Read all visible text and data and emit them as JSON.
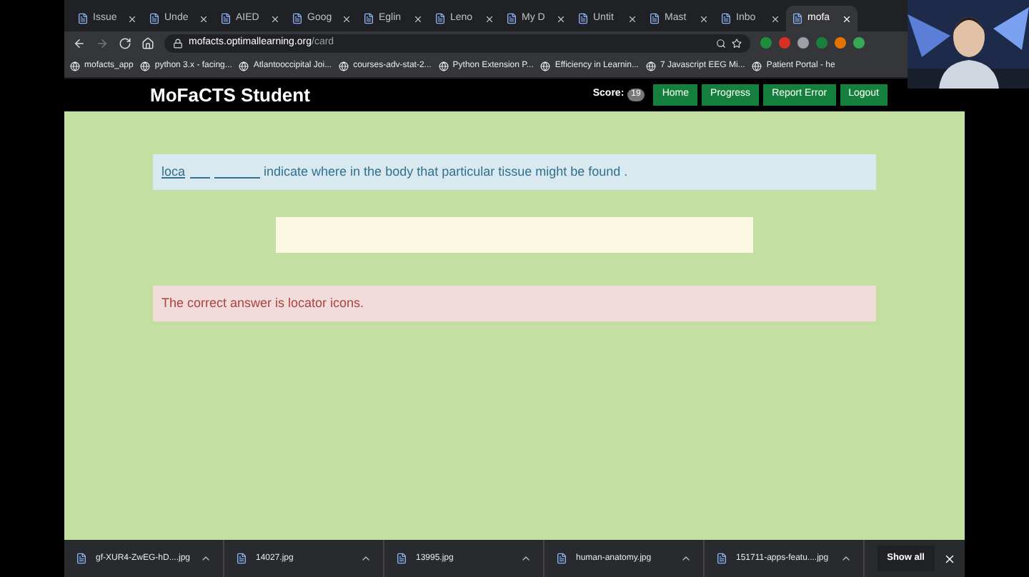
{
  "browser": {
    "tabs": [
      {
        "title": "Issue",
        "selected": false
      },
      {
        "title": "Unde",
        "selected": false
      },
      {
        "title": "AIED",
        "selected": false
      },
      {
        "title": "Goog",
        "selected": false
      },
      {
        "title": "Eglin",
        "selected": false
      },
      {
        "title": "Leno",
        "selected": false
      },
      {
        "title": "My D",
        "selected": false
      },
      {
        "title": "Untit",
        "selected": false
      },
      {
        "title": "Mast",
        "selected": false
      },
      {
        "title": "Inbo",
        "selected": false
      },
      {
        "title": "mofa",
        "selected": true
      }
    ],
    "url": {
      "host": "mofacts.optimallearning.org",
      "path": "/card"
    },
    "bookmarks": [
      "mofacts_app",
      "python 3.x - facing...",
      "Atlantooccipital Joi...",
      "courses-adv-stat-2...",
      "Python Extension P...",
      "Efficiency in Learnin...",
      "7 Javascript EEG Mi...",
      "Patient Portal - he"
    ]
  },
  "app": {
    "title": "MoFaCTS Student",
    "score_label": "Score:",
    "score": "19",
    "nav": [
      "Home",
      "Progress",
      "Report Error",
      "Logout"
    ]
  },
  "card": {
    "prompt_hint": "loca",
    "prompt_text": "indicate where in the body that particular tissue might be found .",
    "feedback": "The correct answer is locator icons."
  },
  "downloads": {
    "files": [
      "gf-XUR4-ZwEG-hD....jpg",
      "14027.jpg",
      "13995.jpg",
      "human-anatomy.jpg",
      "151711-apps-featu....jpg"
    ],
    "show_all": "Show all"
  }
}
